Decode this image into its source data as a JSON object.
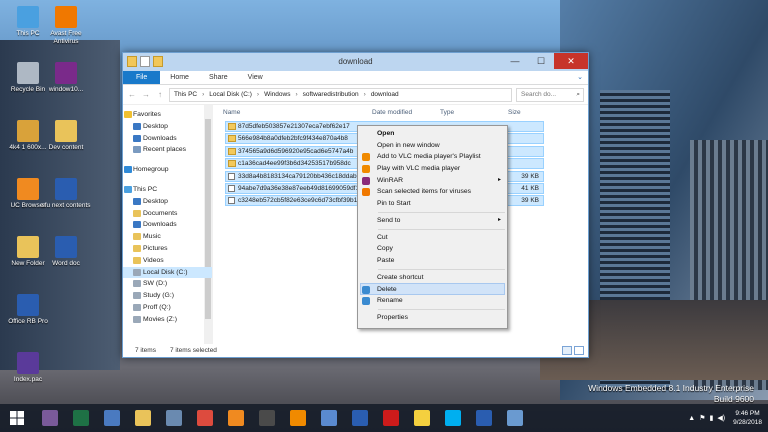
{
  "desktop": {
    "icons": [
      {
        "label": "This PC",
        "color": "#4aa0e0"
      },
      {
        "label": "Avast Free Antivirus",
        "color": "#f07800"
      },
      {
        "label": "Recycle Bin",
        "color": "#aeb8c4"
      },
      {
        "label": "window10...",
        "color": "#7a2a8a"
      },
      {
        "label": "4k4 1 600x...",
        "color": "#d9a23a"
      },
      {
        "label": "Dev content",
        "color": "#e9c35a"
      },
      {
        "label": "UC Browser",
        "color": "#f08a20"
      },
      {
        "label": "sfu next contents",
        "color": "#2a5db0"
      },
      {
        "label": "New Folder",
        "color": "#e9c35a"
      },
      {
        "label": "Word doc",
        "color": "#2a5db0"
      },
      {
        "label": "Office RB Pro",
        "color": "#2a5db0"
      },
      {
        "label": "Index.pac",
        "color": "#5a3a9a"
      }
    ],
    "watermark_line1": "Windows Embedded 8.1 Industry Enterprise",
    "watermark_line2": "Build 9600"
  },
  "window": {
    "title": "download",
    "minimize": "—",
    "maximize": "☐",
    "close": "✕",
    "ribbon_tabs": [
      "File",
      "Home",
      "Share",
      "View"
    ],
    "expand": "⌄",
    "back": "←",
    "forward": "→",
    "up": "↑",
    "breadcrumb": [
      "This PC",
      "Local Disk (C:)",
      "Windows",
      "softwaredistribution",
      "download"
    ],
    "search_placeholder": "Search do...",
    "search_icon": "⌕",
    "columns": [
      "Name",
      "Date modified",
      "Type",
      "Size"
    ],
    "nav_items": [
      {
        "label": "Favorites",
        "top": true,
        "icon": "#f0c030"
      },
      {
        "label": "Desktop",
        "top": false,
        "icon": "#3a78c4"
      },
      {
        "label": "Downloads",
        "top": false,
        "icon": "#3a78c4"
      },
      {
        "label": "Recent places",
        "top": false,
        "icon": "#7a9ac0"
      },
      {
        "label": "",
        "gap": true
      },
      {
        "label": "Homegroup",
        "top": true,
        "icon": "#2f8ad8"
      },
      {
        "label": "",
        "gap": true
      },
      {
        "label": "This PC",
        "top": true,
        "icon": "#4aa0e0"
      },
      {
        "label": "Desktop",
        "top": false,
        "icon": "#3a78c4"
      },
      {
        "label": "Documents",
        "top": false,
        "icon": "#e9c35a"
      },
      {
        "label": "Downloads",
        "top": false,
        "icon": "#3a78c4"
      },
      {
        "label": "Music",
        "top": false,
        "icon": "#e9c35a"
      },
      {
        "label": "Pictures",
        "top": false,
        "icon": "#e9c35a"
      },
      {
        "label": "Videos",
        "top": false,
        "icon": "#e9c35a"
      },
      {
        "label": "Local Disk (C:)",
        "top": false,
        "icon": "#9aa8b8",
        "selected": true
      },
      {
        "label": "SW (D:)",
        "top": false,
        "icon": "#9aa8b8"
      },
      {
        "label": "Study (G:)",
        "top": false,
        "icon": "#9aa8b8"
      },
      {
        "label": "Proff (Q:)",
        "top": false,
        "icon": "#9aa8b8"
      },
      {
        "label": "Movies (Z:)",
        "top": false,
        "icon": "#9aa8b8"
      }
    ],
    "files": [
      {
        "name": "87d5dfeb503857e21307eca7ebf62e17",
        "kind": "folder",
        "size": ""
      },
      {
        "name": "566e984b8a0dfeb2bfc9f434e870a4b8",
        "kind": "folder",
        "size": ""
      },
      {
        "name": "374565a9d6d596920e95cad6e5747a4b",
        "kind": "folder",
        "size": ""
      },
      {
        "name": "c1a36cad4ee99f3b6d34253517b958dc",
        "kind": "folder",
        "size": ""
      },
      {
        "name": "33d8a4b8183134ca79120bb436c18ddab71...",
        "kind": "file",
        "size": "39 KB"
      },
      {
        "name": "94abe7d9a36e38e87eeb49d81699059df18...",
        "kind": "file",
        "size": "41 KB"
      },
      {
        "name": "c3248eb572cb5f82e63ce9c6d73cfbf39b10...",
        "kind": "file",
        "size": "39 KB"
      }
    ],
    "status_count": "7 items",
    "status_selected": "7 items selected"
  },
  "context_menu": {
    "items": [
      {
        "label": "Open",
        "bold": true
      },
      {
        "label": "Open in new window"
      },
      {
        "label": "Add to VLC media player's Playlist",
        "icon": "#f08a00"
      },
      {
        "label": "Play with VLC media player",
        "icon": "#f08a00"
      },
      {
        "label": "WinRAR",
        "icon": "#8a2a7a",
        "submenu": true
      },
      {
        "label": "Scan selected items for viruses",
        "icon": "#f07800"
      },
      {
        "label": "Pin to Start"
      },
      {
        "sep": true
      },
      {
        "label": "Send to",
        "submenu": true
      },
      {
        "sep": true
      },
      {
        "label": "Cut"
      },
      {
        "label": "Copy"
      },
      {
        "label": "Paste"
      },
      {
        "sep": true
      },
      {
        "label": "Create shortcut"
      },
      {
        "label": "Delete",
        "icon": "#3a8ad0",
        "highlight": true
      },
      {
        "label": "Rename",
        "icon": "#3a8ad0"
      },
      {
        "sep": true
      },
      {
        "label": "Properties"
      }
    ],
    "submenu_arrow": "▸"
  },
  "taskbar": {
    "apps": [
      {
        "name": "chrome-alt",
        "color": "#7a5a9a"
      },
      {
        "name": "excel",
        "color": "#1e7145"
      },
      {
        "name": "display",
        "color": "#4a7ac0"
      },
      {
        "name": "file-explorer",
        "color": "#e9c35a"
      },
      {
        "name": "tools",
        "color": "#6a8ab0"
      },
      {
        "name": "chrome",
        "color": "#dd4b3e"
      },
      {
        "name": "uc-browser",
        "color": "#f08a20"
      },
      {
        "name": "calculator",
        "color": "#4a4a4a"
      },
      {
        "name": "vlc",
        "color": "#f08a00"
      },
      {
        "name": "notes",
        "color": "#5a8ad0"
      },
      {
        "name": "app-blue",
        "color": "#2a5db0"
      },
      {
        "name": "opera",
        "color": "#cc1b1b"
      },
      {
        "name": "sticky",
        "color": "#f4d03f"
      },
      {
        "name": "skype",
        "color": "#00aff0"
      },
      {
        "name": "word",
        "color": "#2a5db0"
      },
      {
        "name": "paint",
        "color": "#6a9ad0"
      }
    ],
    "time": "9:46 PM",
    "date": "9/28/2018",
    "tray_up": "▲",
    "tray_flag": "⚑",
    "tray_net": "▮",
    "tray_vol": "◀)"
  }
}
